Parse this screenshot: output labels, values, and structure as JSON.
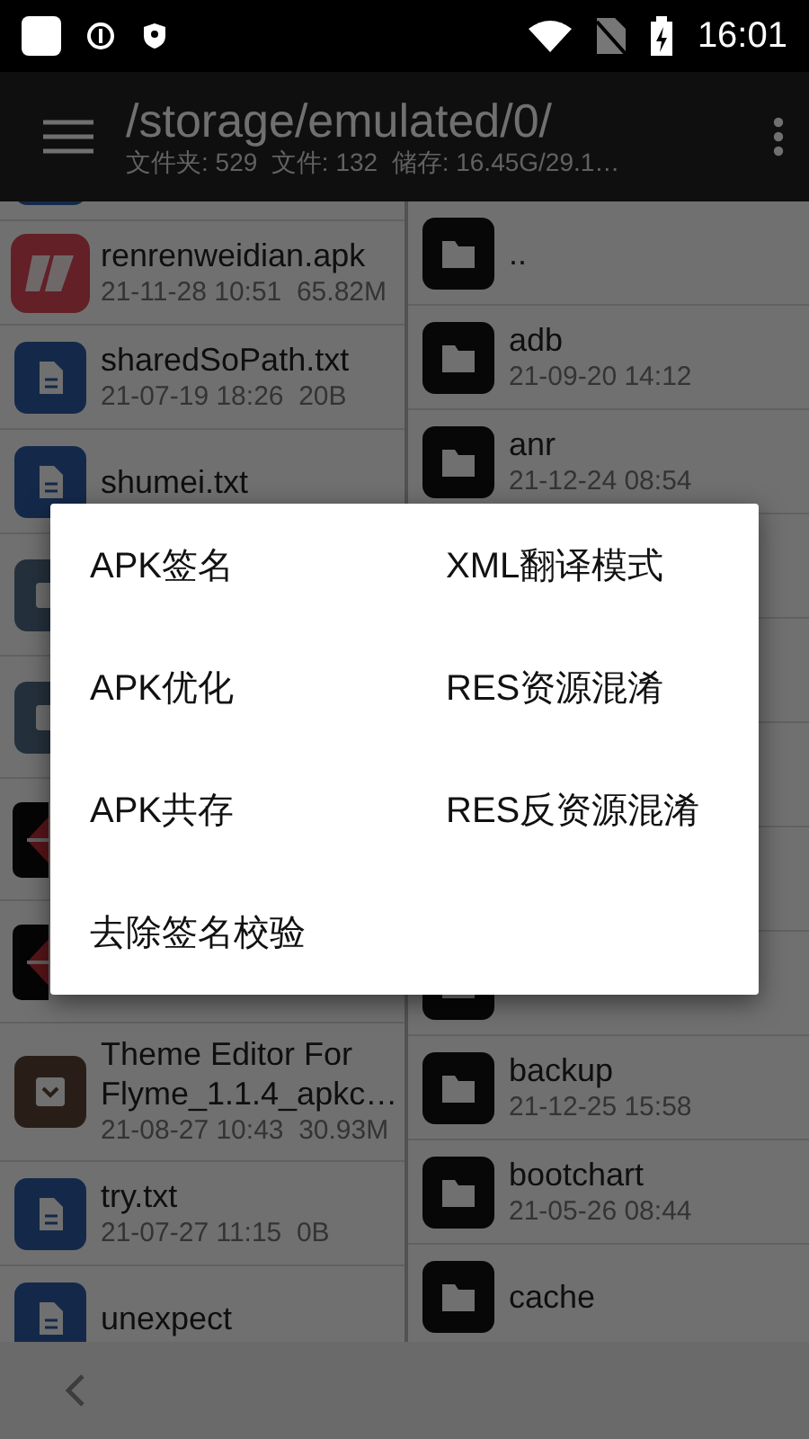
{
  "status_bar": {
    "time": "16:01"
  },
  "app_bar": {
    "path": "/storage/emulated/0/",
    "summary": "文件夹: 529  文件: 132  储存: 16.45G/29.1…"
  },
  "left_pane": {
    "files": [
      {
        "kind": "doc"
      },
      {
        "kind": "apk",
        "name": "renrenweidian.apk",
        "info": "21-11-28 10:51  65.82M"
      },
      {
        "kind": "doc",
        "name": "sharedSoPath.txt",
        "info": "21-07-19 18:26  20B"
      },
      {
        "kind": "doc",
        "name": "shumei.txt"
      },
      {
        "kind": "app"
      },
      {
        "kind": "app"
      },
      {
        "kind": "logo"
      },
      {
        "kind": "logo"
      },
      {
        "kind": "archive",
        "name": "Theme Editor For Flyme_1.1.4_apkc…",
        "info": "21-08-27 10:43  30.93M"
      },
      {
        "kind": "doc",
        "name": "try.txt",
        "info": "21-07-27 11:15  0B"
      },
      {
        "kind": "doc",
        "name": "unexpect"
      }
    ]
  },
  "right_pane": {
    "files": [
      {
        "kind": "folder",
        "name": ".."
      },
      {
        "kind": "folder",
        "name": "adb",
        "info": "21-09-20 14:12"
      },
      {
        "kind": "folder",
        "name": "anr",
        "info": "21-12-24 08:54"
      },
      {
        "kind": "folder"
      },
      {
        "kind": "folder",
        "name": "backup",
        "info": "21-12-25 15:58"
      },
      {
        "kind": "folder",
        "name": "bootchart",
        "info": "21-05-26 08:44"
      },
      {
        "kind": "folder",
        "name": "cache"
      }
    ]
  },
  "dialog": {
    "items": [
      "APK签名",
      "XML翻译模式",
      "APK优化",
      "RES资源混淆",
      "APK共存",
      "RES反资源混淆",
      "去除签名校验"
    ]
  }
}
